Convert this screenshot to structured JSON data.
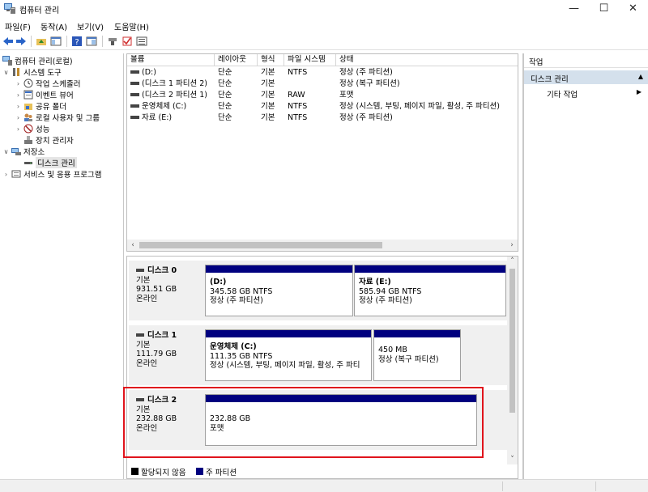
{
  "window": {
    "title": "컴퓨터 관리",
    "controls": [
      "—",
      "☐",
      "✕"
    ]
  },
  "menu": [
    "파일(F)",
    "동작(A)",
    "보기(V)",
    "도움말(H)"
  ],
  "tree": {
    "root": "컴퓨터 관리(로컬)",
    "system_tools": "시스템 도구",
    "task_scheduler": "작업 스케줄러",
    "event_viewer": "이벤트 뷰어",
    "shared_folders": "공유 폴더",
    "local_users": "로컬 사용자 및 그룹",
    "performance": "성능",
    "device_manager": "장치 관리자",
    "storage": "저장소",
    "disk_management": "디스크 관리",
    "services": "서비스 및 응용 프로그램"
  },
  "volume_list": {
    "columns": [
      "볼륨",
      "레이아웃",
      "형식",
      "파일 시스템",
      "상태"
    ],
    "rows": [
      [
        "(D:)",
        "단순",
        "기본",
        "NTFS",
        "정상 (주 파티션)"
      ],
      [
        "(디스크 1 파티션 2)",
        "단순",
        "기본",
        "",
        "정상 (복구 파티션)"
      ],
      [
        "(디스크 2 파티션 1)",
        "단순",
        "기본",
        "RAW",
        "포맷"
      ],
      [
        "운영체제 (C:)",
        "단순",
        "기본",
        "NTFS",
        "정상 (시스템, 부팅, 페이지 파일, 활성, 주 파티션)"
      ],
      [
        "자료 (E:)",
        "단순",
        "기본",
        "NTFS",
        "정상 (주 파티션)"
      ]
    ]
  },
  "disks": [
    {
      "name": "디스크 0",
      "type": "기본",
      "size": "931.51 GB",
      "status": "온라인",
      "partitions": [
        {
          "label": "(D:)",
          "detail": "345.58 GB NTFS",
          "status": "정상 (주 파티션)"
        },
        {
          "label": "자료  (E:)",
          "detail": "585.94 GB NTFS",
          "status": "정상 (주 파티션)"
        }
      ]
    },
    {
      "name": "디스크 1",
      "type": "기본",
      "size": "111.79 GB",
      "status": "온라인",
      "partitions": [
        {
          "label": "운영체제  (C:)",
          "detail": "111.35 GB NTFS",
          "status": "정상 (시스템, 부팅, 페이지 파일, 활성, 주 파티"
        },
        {
          "label": "",
          "detail": "450 MB",
          "status": "정상 (복구 파티션)"
        }
      ]
    },
    {
      "name": "디스크 2",
      "type": "기본",
      "size": "232.88 GB",
      "status": "온라인",
      "partitions": [
        {
          "label": "",
          "detail": "232.88 GB",
          "status": "포맷"
        }
      ]
    }
  ],
  "legend": {
    "unallocated": "할당되지 않음",
    "primary": "주 파티션"
  },
  "actions": {
    "header": "작업",
    "section": "디스크 관리",
    "more": "기타 작업"
  },
  "colors": {
    "partition_bar": "#00007f",
    "unallocated": "#000000",
    "highlight": "#e0141c",
    "actions_section": "#d4e0ec"
  }
}
